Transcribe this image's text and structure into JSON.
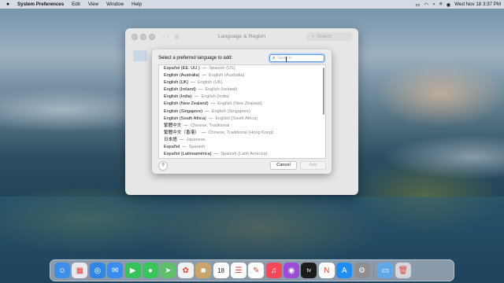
{
  "menubar": {
    "app_name": "System Preferences",
    "menus": [
      "Edit",
      "View",
      "Window",
      "Help"
    ],
    "clock": "Wed Nov 18  3:37 PM"
  },
  "window": {
    "title": "Language & Region",
    "search_placeholder": "Search"
  },
  "sheet": {
    "prompt": "Select a preferred language to add:",
    "search_placeholder": "Search",
    "languages": [
      {
        "native": "Español (EE. UU.)",
        "english": "Spanish (US)"
      },
      {
        "native": "English (Australia)",
        "english": "English (Australia)"
      },
      {
        "native": "English (UK)",
        "english": "English (UK)"
      },
      {
        "native": "English (Ireland)",
        "english": "English (Ireland)"
      },
      {
        "native": "English (India)",
        "english": "English (India)"
      },
      {
        "native": "English (New Zealand)",
        "english": "English (New Zealand)"
      },
      {
        "native": "English (Singapore)",
        "english": "English (Singapore)"
      },
      {
        "native": "English (South Africa)",
        "english": "English (South Africa)"
      },
      {
        "native": "繁體中文",
        "english": "Chinese, Traditional"
      },
      {
        "native": "繁體中文（香港）",
        "english": "Chinese, Traditional (Hong Kong)"
      },
      {
        "native": "日本語",
        "english": "Japanese"
      },
      {
        "native": "Español",
        "english": "Spanish"
      },
      {
        "native": "Español (Latinoamérica)",
        "english": "Spanish (Latin America)"
      }
    ],
    "separator": "—",
    "help_label": "?",
    "cancel_label": "Cancel",
    "add_label": "Add"
  },
  "dock": {
    "apps": [
      {
        "icon": "finder-icon",
        "glyph": "☺",
        "color": "#3d8ee8"
      },
      {
        "icon": "launchpad-icon",
        "glyph": "▦",
        "color": "#e8e8ee"
      },
      {
        "icon": "safari-icon",
        "glyph": "◎",
        "color": "#2f86e0"
      },
      {
        "icon": "mail-icon",
        "glyph": "✉",
        "color": "#3a8df0"
      },
      {
        "icon": "facetime-icon",
        "glyph": "▶",
        "color": "#35c25a"
      },
      {
        "icon": "messages-icon",
        "glyph": "●",
        "color": "#3ac55b"
      },
      {
        "icon": "maps-icon",
        "glyph": "➤",
        "color": "#5fbf6a"
      },
      {
        "icon": "photos-icon",
        "glyph": "✿",
        "color": "#f1f1f1"
      },
      {
        "icon": "contacts-icon",
        "glyph": "☻",
        "color": "#c9a46c"
      },
      {
        "icon": "calendar-icon",
        "glyph": "18",
        "color": "#ffffff"
      },
      {
        "icon": "reminders-icon",
        "glyph": "☰",
        "color": "#ffffff"
      },
      {
        "icon": "notes-icon",
        "glyph": "✎",
        "color": "#ffffff"
      },
      {
        "icon": "music-icon",
        "glyph": "♫",
        "color": "#f34a5b"
      },
      {
        "icon": "podcasts-icon",
        "glyph": "◉",
        "color": "#9d4cd8"
      },
      {
        "icon": "tv-icon",
        "glyph": "tv",
        "color": "#1b1b1b"
      },
      {
        "icon": "news-icon",
        "glyph": "N",
        "color": "#ffffff"
      },
      {
        "icon": "app-store-icon",
        "glyph": "A",
        "color": "#1f8df3"
      },
      {
        "icon": "system-preferences-icon",
        "glyph": "⚙",
        "color": "#8e8e93"
      }
    ],
    "extras": [
      {
        "icon": "downloads-folder-icon",
        "glyph": "▭",
        "color": "#62a8e8"
      },
      {
        "icon": "trash-icon",
        "glyph": "🗑",
        "color": "#d6d6dc"
      }
    ]
  }
}
